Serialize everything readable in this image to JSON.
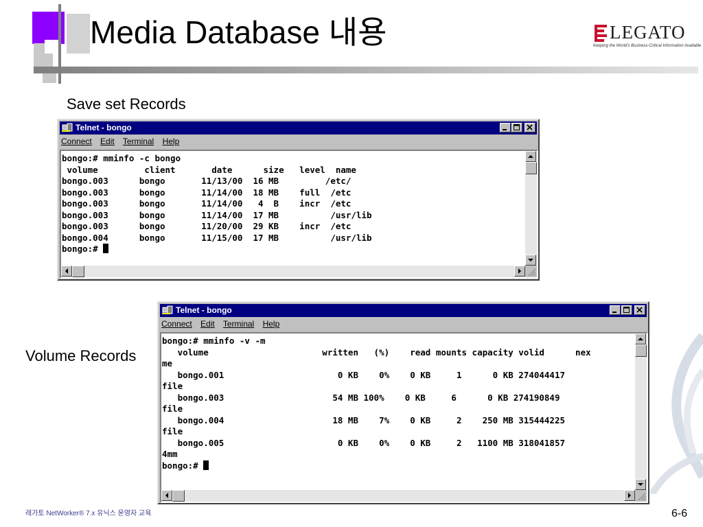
{
  "slide": {
    "title": "Media Database 내용",
    "label_save": "Save set Records",
    "label_volume": "Volume Records",
    "footer": "레가토 NetWorker® 7.x 유닉스 운영자 교육",
    "page_number": "6-6"
  },
  "logo": {
    "text": "LEGATO",
    "tagline": "Keeping the World's Business-Critical Information Available"
  },
  "window1": {
    "title": "Telnet - bongo",
    "menu": [
      "Connect",
      "Edit",
      "Terminal",
      "Help"
    ],
    "terminal_text": "bongo:# mminfo -c bongo\n volume         client       date      size   level  name\nbongo.003      bongo       11/13/00  16 MB         /etc/\nbongo.003      bongo       11/14/00  18 MB    full  /etc\nbongo.003      bongo       11/14/00   4  B    incr  /etc\nbongo.003      bongo       11/14/00  17 MB          /usr/lib\nbongo.003      bongo       11/20/00  29 KB    incr  /etc\nbongo.004      bongo       11/15/00  17 MB          /usr/lib\nbongo:# "
  },
  "window2": {
    "title": "Telnet - bongo",
    "menu": [
      "Connect",
      "Edit",
      "Terminal",
      "Help"
    ],
    "terminal_text": "bongo:# mminfo -v -m\n   volume                      written   (%)    read mounts capacity volid      nex\nme\n   bongo.001                      0 KB    0%    0 KB     1      0 KB 274044417\nfile\n   bongo.003                     54 MB 100%    0 KB     6      0 KB 274190849\nfile\n   bongo.004                     18 MB    7%    0 KB     2    250 MB 315444225\nfile\n   bongo.005                      0 KB    0%    0 KB     2   1100 MB 318041857\n4mm\nbongo:# "
  },
  "colors": {
    "titlebar": "#000080",
    "accent_purple": "#8b00ff",
    "logo_red": "#c8102e"
  }
}
